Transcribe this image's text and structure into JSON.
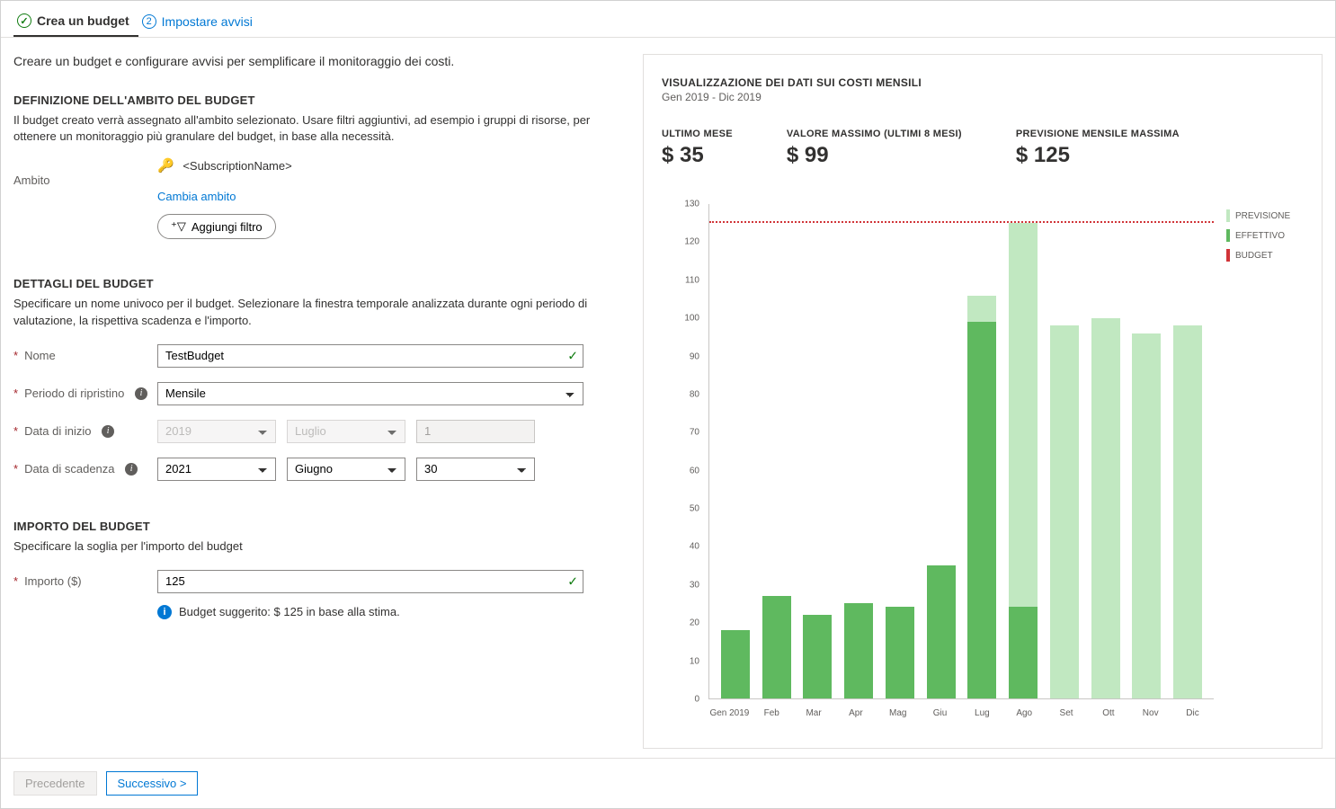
{
  "tabs": {
    "create": {
      "label": "Crea un budget",
      "icon": "✓"
    },
    "alerts": {
      "label": "Impostare avvisi",
      "icon": "2"
    }
  },
  "intro": "Creare un budget e configurare avvisi per semplificare il monitoraggio dei costi.",
  "scope_section": {
    "title": "DEFINIZIONE DELL'AMBITO DEL BUDGET",
    "desc": "Il budget creato verrà assegnato all'ambito selezionato. Usare filtri aggiuntivi, ad esempio i gruppi di risorse, per ottenere un monitoraggio più granulare del budget, in base alla necessità.",
    "scope_label": "Ambito",
    "subscription": "<SubscriptionName>",
    "change_scope": "Cambia ambito",
    "add_filter": "Aggiungi filtro"
  },
  "details_section": {
    "title": "DETTAGLI DEL BUDGET",
    "desc": "Specificare un nome univoco per il budget. Selezionare la finestra temporale analizzata durante ogni periodo di valutazione, la rispettiva scadenza e l'importo.",
    "name_label": "Nome",
    "name_value": "TestBudget",
    "reset_label": "Periodo di ripristino",
    "reset_value": "Mensile",
    "start_label": "Data di inizio",
    "start_year": "2019",
    "start_month": "Luglio",
    "start_day": "1",
    "end_label": "Data di scadenza",
    "end_year": "2021",
    "end_month": "Giugno",
    "end_day": "30"
  },
  "amount_section": {
    "title": "IMPORTO DEL BUDGET",
    "desc": "Specificare la soglia per l'importo del budget",
    "amount_label": "Importo ($)",
    "amount_value": "125",
    "hint": "Budget suggerito: $ 125 in base alla stima."
  },
  "chart": {
    "title": "VISUALIZZAZIONE DEI DATI SUI COSTI MENSILI",
    "subtitle": "Gen 2019 - Dic 2019",
    "stats": {
      "last_month_label": "ULTIMO MESE",
      "last_month_value": "$ 35",
      "max_label": "VALORE MASSIMO (ULTIMI 8 MESI)",
      "max_value": "$ 99",
      "forecast_label": "PREVISIONE MENSILE MASSIMA",
      "forecast_value": "$ 125"
    },
    "legend": {
      "forecast": "PREVISIONE",
      "actual": "EFFETTIVO",
      "budget": "BUDGET"
    }
  },
  "chart_data": {
    "type": "bar",
    "categories": [
      "Gen 2019",
      "Feb",
      "Mar",
      "Apr",
      "Mag",
      "Giu",
      "Lug",
      "Ago",
      "Set",
      "Ott",
      "Nov",
      "Dic"
    ],
    "series": [
      {
        "name": "Effettivo",
        "values": [
          18,
          27,
          22,
          25,
          24,
          35,
          99,
          24,
          null,
          null,
          null,
          null
        ]
      },
      {
        "name": "Previsione",
        "values": [
          null,
          null,
          null,
          null,
          null,
          null,
          106,
          125,
          98,
          100,
          96,
          98
        ]
      }
    ],
    "budget_line": 125,
    "ylim": [
      0,
      130
    ],
    "y_ticks": [
      0,
      10,
      20,
      30,
      40,
      50,
      60,
      70,
      80,
      90,
      100,
      110,
      120,
      130
    ],
    "xlabel": "",
    "ylabel": ""
  },
  "footer": {
    "prev": "Precedente",
    "next": "Successivo >"
  },
  "colors": {
    "actual": "#5fb95f",
    "forecast": "#c1e8c1",
    "budget": "#d13438"
  }
}
